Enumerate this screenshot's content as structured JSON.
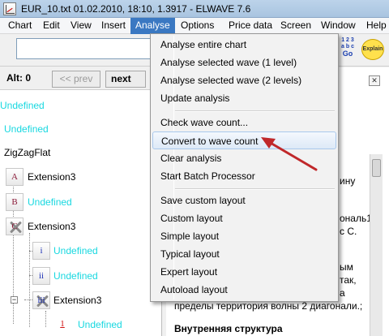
{
  "window": {
    "title": "EUR_10.txt  01.02.2010, 18:10, 1.3917 - ELWAVE 7.6"
  },
  "menubar": {
    "items": [
      "Chart",
      "Edit",
      "View",
      "Insert",
      "Analyse",
      "Options",
      "Price data",
      "Screen",
      "Window",
      "Help"
    ],
    "active": "Analyse"
  },
  "toolbar": {
    "input_value": "",
    "icon1": {
      "top": "1 2 3",
      "mid": "a b c",
      "go": "Go"
    },
    "icon2_text": "Explain"
  },
  "wave_tree": {
    "alt_label": "Alt: 0",
    "prev_label": "<< prev",
    "next_label": "next",
    "rows": [
      {
        "label": "Undefined",
        "color": "#18d8e0"
      },
      {
        "label": "Undefined",
        "color": "#18d8e0"
      },
      {
        "label": "ZigZagFlat",
        "color": "#000000"
      },
      {
        "node": "A",
        "label": "Extension3",
        "color": "#000000"
      },
      {
        "node": "B",
        "label": "Undefined",
        "color": "#18d8e0"
      },
      {
        "node": "C",
        "label": "Extension3",
        "color": "#000000"
      },
      {
        "node": "i",
        "label": "Undefined",
        "color": "#18d8e0"
      },
      {
        "node": "ii",
        "label": "Undefined",
        "color": "#18d8e0"
      },
      {
        "node": "iii",
        "label": "Extension3",
        "color": "#000000"
      },
      {
        "node": "1",
        "label": "Undefined",
        "color": "#18d8e0"
      }
    ]
  },
  "analysis_text": {
    "lines": [
      "ину",
      "ональ1",
      "с С.",
      "ым",
      "так,",
      "а",
      "пределы территория волны 2 диагонали.;",
      "Внутренняя структура"
    ]
  },
  "analyse_menu": {
    "items": [
      "Analyse entire chart",
      "Analyse selected wave (1 level)",
      "Analyse selected wave (2 levels)",
      "Update analysis",
      "Check wave count...",
      "Convert to wave count",
      "Clear analysis",
      "Start Batch Processor",
      "Save custom layout",
      "Custom layout",
      "Simple layout",
      "Typical layout",
      "Expert layout",
      "Autoload layout"
    ],
    "highlighted": "Convert to wave count"
  },
  "annotation": {
    "arrow_color": "#c0282a"
  }
}
